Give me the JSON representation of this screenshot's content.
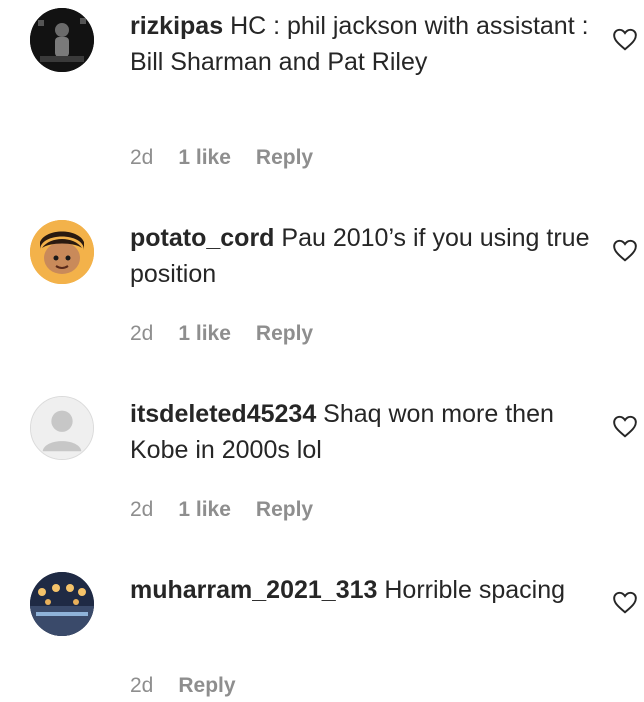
{
  "comments": [
    {
      "username": "rizkipas",
      "text": "HC : phil jackson with assistant : Bill Sharman and Pat Riley",
      "time": "2d",
      "likes": "1 like",
      "reply": "Reply",
      "avatar_icon": "avatar-photo",
      "avatar_color": "#1a1a1a"
    },
    {
      "username": "potato_cord",
      "text": "Pau 2010’s if you using true position",
      "time": "2d",
      "likes": "1 like",
      "reply": "Reply",
      "avatar_icon": "cartoon-avatar",
      "avatar_color": "#f2a93b"
    },
    {
      "username": "itsdeleted45234",
      "text": "Shaq won more then Kobe in 2000s lol",
      "time": "2d",
      "likes": "1 like",
      "reply": "Reply",
      "avatar_icon": "default-avatar",
      "avatar_color": "#dbdbdb"
    },
    {
      "username": "muharram_2021_313",
      "text": "Horrible spacing",
      "time": "2d",
      "likes": "",
      "reply": "Reply",
      "avatar_icon": "avatar-photo",
      "avatar_color": "#2b3550"
    }
  ],
  "colors": {
    "text": "#262626",
    "meta": "#8e8e8e",
    "heart": "#262626"
  }
}
